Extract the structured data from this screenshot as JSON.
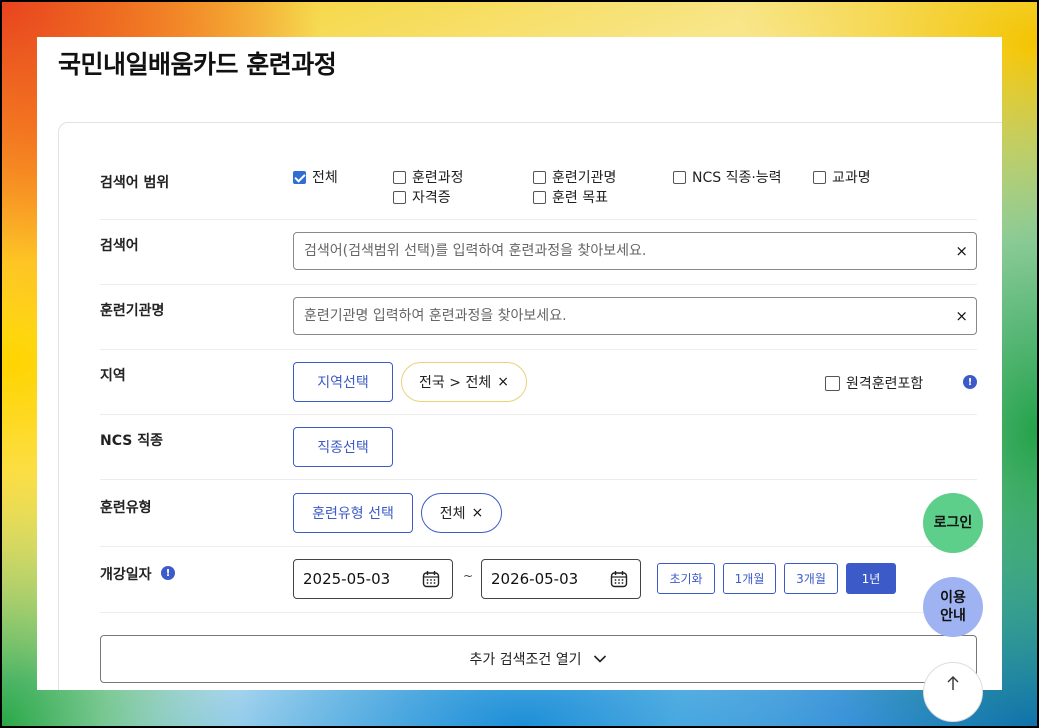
{
  "page": {
    "title": "국민내일배움카드 훈련과정"
  },
  "search_scope": {
    "label": "검색어 범위",
    "options": [
      {
        "label": "전체",
        "checked": true
      },
      {
        "label": "훈련과정",
        "checked": false
      },
      {
        "label": "훈련기관명",
        "checked": false
      },
      {
        "label": "NCS 직종·능력",
        "checked": false
      },
      {
        "label": "교과명",
        "checked": false
      },
      {
        "label": "자격증",
        "checked": false
      },
      {
        "label": "훈련 목표",
        "checked": false
      }
    ]
  },
  "keyword": {
    "label": "검색어",
    "placeholder": "검색어(검색범위 선택)를 입력하여 훈련과정을 찾아보세요.",
    "value": "",
    "clear": "×"
  },
  "institution": {
    "label": "훈련기관명",
    "placeholder": "훈련기관명 입력하여 훈련과정을 찾아보세요.",
    "value": "",
    "clear": "×"
  },
  "region": {
    "label": "지역",
    "button": "지역선택",
    "chip": "전국 > 전체",
    "chip_remove": "×",
    "remote_label": "원격훈련포함",
    "remote_checked": false,
    "info": "!"
  },
  "ncs": {
    "label": "NCS 직종",
    "button": "직종선택"
  },
  "training_type": {
    "label": "훈련유형",
    "button": "훈련유형 선택",
    "chip": "전체",
    "chip_remove": "×"
  },
  "open_date": {
    "label": "개강일자",
    "info": "!",
    "start": "2025-05-03",
    "separator": "~",
    "end": "2026-05-03",
    "presets": [
      {
        "label": "초기화",
        "active": false
      },
      {
        "label": "1개월",
        "active": false
      },
      {
        "label": "3개월",
        "active": false
      },
      {
        "label": "1년",
        "active": true
      }
    ]
  },
  "more": {
    "label": "추가 검색조건 열기",
    "icon": "chevron-down-icon"
  },
  "floating": {
    "login": "로그인",
    "guide_line1": "이용",
    "guide_line2": "안내",
    "top_icon": "arrow-up-icon"
  },
  "colors": {
    "accent": "#3d5bc8",
    "chip_region_border": "#e8d27a",
    "login_bg": "#5dcf8a",
    "guide_bg": "#9fb3f3"
  }
}
